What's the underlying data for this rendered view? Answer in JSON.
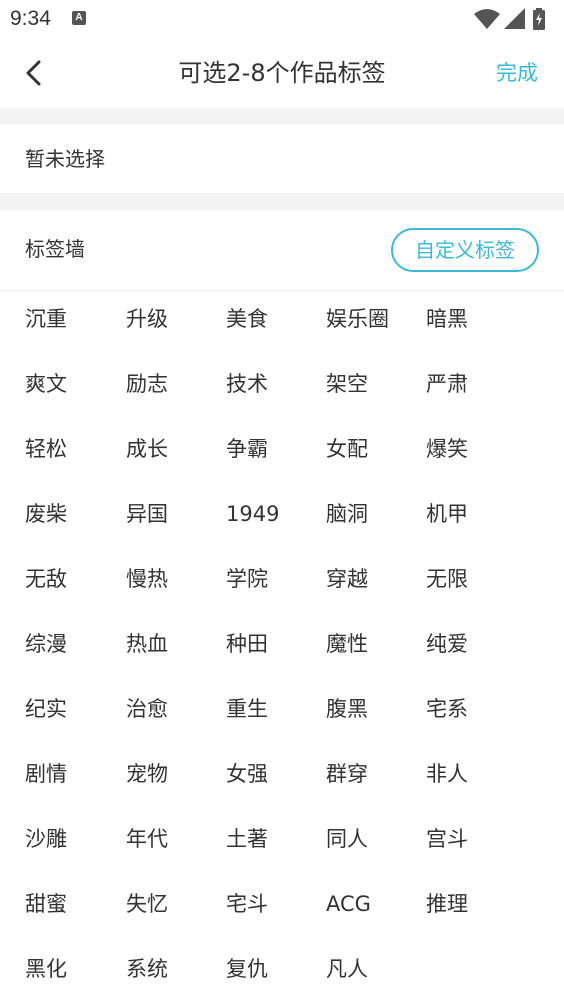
{
  "status_bar": {
    "time": "9:34",
    "notification_icon": "A"
  },
  "nav": {
    "back_icon": "chevron-left-icon",
    "title": "可选2-8个作品标签",
    "done_label": "完成"
  },
  "selected": {
    "empty_text": "暂未选择"
  },
  "tag_wall": {
    "title": "标签墙",
    "custom_button_label": "自定义标签",
    "rows": [
      [
        "沉重",
        "升级",
        "美食",
        "娱乐圈",
        "暗黑"
      ],
      [
        "爽文",
        "励志",
        "技术",
        "架空",
        "严肃"
      ],
      [
        "轻松",
        "成长",
        "争霸",
        "女配",
        "爆笑"
      ],
      [
        "废柴",
        "异国",
        "1949",
        "脑洞",
        "机甲"
      ],
      [
        "无敌",
        "慢热",
        "学院",
        "穿越",
        "无限"
      ],
      [
        "综漫",
        "热血",
        "种田",
        "魔性",
        "纯爱"
      ],
      [
        "纪实",
        "治愈",
        "重生",
        "腹黑",
        "宅系"
      ],
      [
        "剧情",
        "宠物",
        "女强",
        "群穿",
        "非人"
      ],
      [
        "沙雕",
        "年代",
        "土著",
        "同人",
        "宫斗"
      ],
      [
        "甜蜜",
        "失忆",
        "宅斗",
        "ACG",
        "推理"
      ],
      [
        "黑化",
        "系统",
        "复仇",
        "凡人"
      ]
    ]
  },
  "colors": {
    "accent": "#3cb9d9",
    "text": "#333333",
    "divider": "#f4f4f4"
  }
}
